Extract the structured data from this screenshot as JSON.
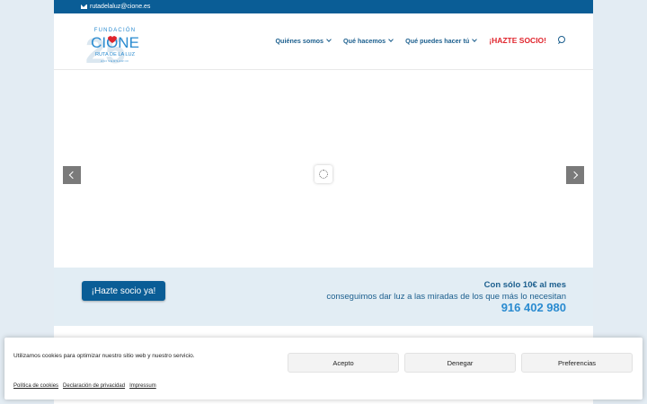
{
  "topbar": {
    "email": "rutadelaluz@cione.es",
    "icon": "mail-icon"
  },
  "logo": {
    "line1": "FUNDACIÓN",
    "line2": "CIONE",
    "line3": "RUTA DE LA LUZ",
    "line4": "ANIVERSARIO",
    "big_number": "25"
  },
  "nav": {
    "items": [
      {
        "label": "Quiénes somos"
      },
      {
        "label": "Qué hacemos"
      },
      {
        "label": "Qué puedes hacer tú"
      }
    ],
    "cta": "¡HAZTE SOCIO!",
    "search_icon": "search-icon"
  },
  "band": {
    "button": "¡Hazte socio ya!",
    "line1": "Con sólo 10€ al mes",
    "line2": "conseguimos dar luz a las miradas de los que más lo necesitan",
    "phone": "916 402 980"
  },
  "cookie": {
    "message": "Utilizamos cookies para optimizar nuestro sitio web y nuestro servicio.",
    "accept": "Acepto",
    "deny": "Denegar",
    "prefs": "Preferencias",
    "links": [
      "Política de cookies",
      "Declaración de privacidad",
      "Impressum"
    ]
  },
  "colors": {
    "brand_blue": "#0a5d96",
    "nav_text": "#1c5f8e",
    "cta_red": "#e0242c",
    "phone_blue": "#2a8bd0",
    "band_bg": "#e2edf4"
  }
}
